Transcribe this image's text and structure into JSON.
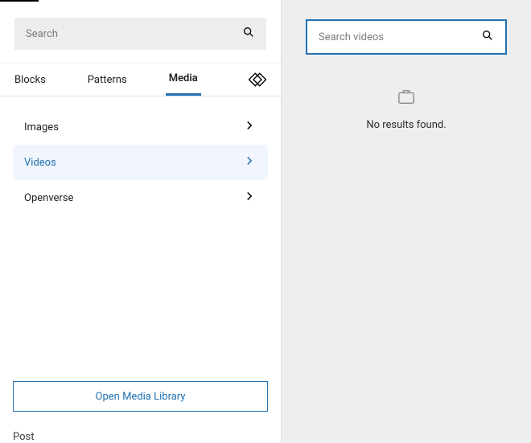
{
  "search": {
    "placeholder": "Search"
  },
  "tabs": {
    "blocks": "Blocks",
    "patterns": "Patterns",
    "media": "Media"
  },
  "categories": {
    "images": "Images",
    "videos": "Videos",
    "openverse": "Openverse"
  },
  "buttons": {
    "openLibrary": "Open Media Library"
  },
  "footer": {
    "post": "Post"
  },
  "rightPanel": {
    "searchPlaceholder": "Search videos",
    "noResults": "No results found."
  }
}
